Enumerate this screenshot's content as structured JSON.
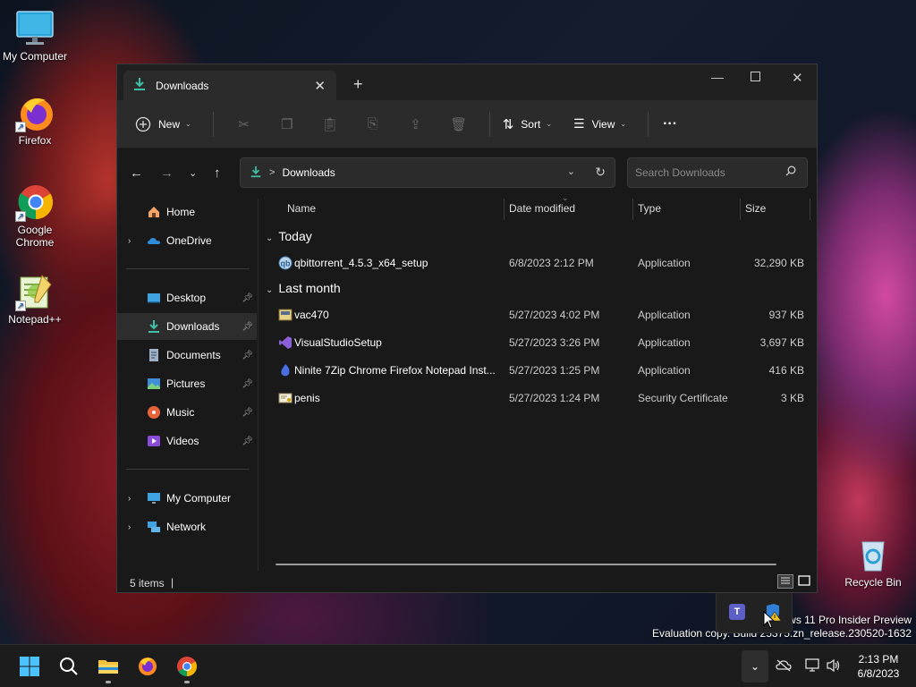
{
  "desktop": {
    "icons": [
      {
        "label": "My Computer"
      },
      {
        "label": "Firefox"
      },
      {
        "label": "Google Chrome"
      },
      {
        "label": "Notepad++"
      },
      {
        "label": "Recycle Bin"
      }
    ],
    "watermark": {
      "line1": "ws 11 Pro Insider Preview",
      "line2": "Evaluation copy. Build 25375.zn_release.230520-1632"
    }
  },
  "window": {
    "tab_title": "Downloads",
    "toolbar": {
      "new_label": "New",
      "sort_label": "Sort",
      "view_label": "View",
      "more_label": "···"
    },
    "address": {
      "separator": ">",
      "location": "Downloads"
    },
    "search": {
      "placeholder": "Search Downloads"
    },
    "nav": {
      "home": "Home",
      "onedrive": "OneDrive",
      "desktop": "Desktop",
      "downloads": "Downloads",
      "documents": "Documents",
      "pictures": "Pictures",
      "music": "Music",
      "videos": "Videos",
      "my_computer": "My Computer",
      "network": "Network"
    },
    "columns": {
      "name": "Name",
      "date": "Date modified",
      "type": "Type",
      "size": "Size"
    },
    "groups": {
      "today": "Today",
      "last_month": "Last month"
    },
    "files": [
      {
        "name": "qbittorrent_4.5.3_x64_setup",
        "date": "6/8/2023 2:12 PM",
        "type": "Application",
        "size": "32,290 KB"
      },
      {
        "name": "vac470",
        "date": "5/27/2023 4:02 PM",
        "type": "Application",
        "size": "937 KB"
      },
      {
        "name": "VisualStudioSetup",
        "date": "5/27/2023 3:26 PM",
        "type": "Application",
        "size": "3,697 KB"
      },
      {
        "name": "Ninite 7Zip Chrome Firefox Notepad Inst...",
        "date": "5/27/2023 1:25 PM",
        "type": "Application",
        "size": "416 KB"
      },
      {
        "name": "penis",
        "date": "5/27/2023 1:24 PM",
        "type": "Security Certificate",
        "size": "3 KB"
      }
    ],
    "status": {
      "items": "5 items",
      "cursor": "|"
    }
  },
  "taskbar": {
    "clock_time": "2:13 PM",
    "clock_date": "6/8/2023"
  }
}
